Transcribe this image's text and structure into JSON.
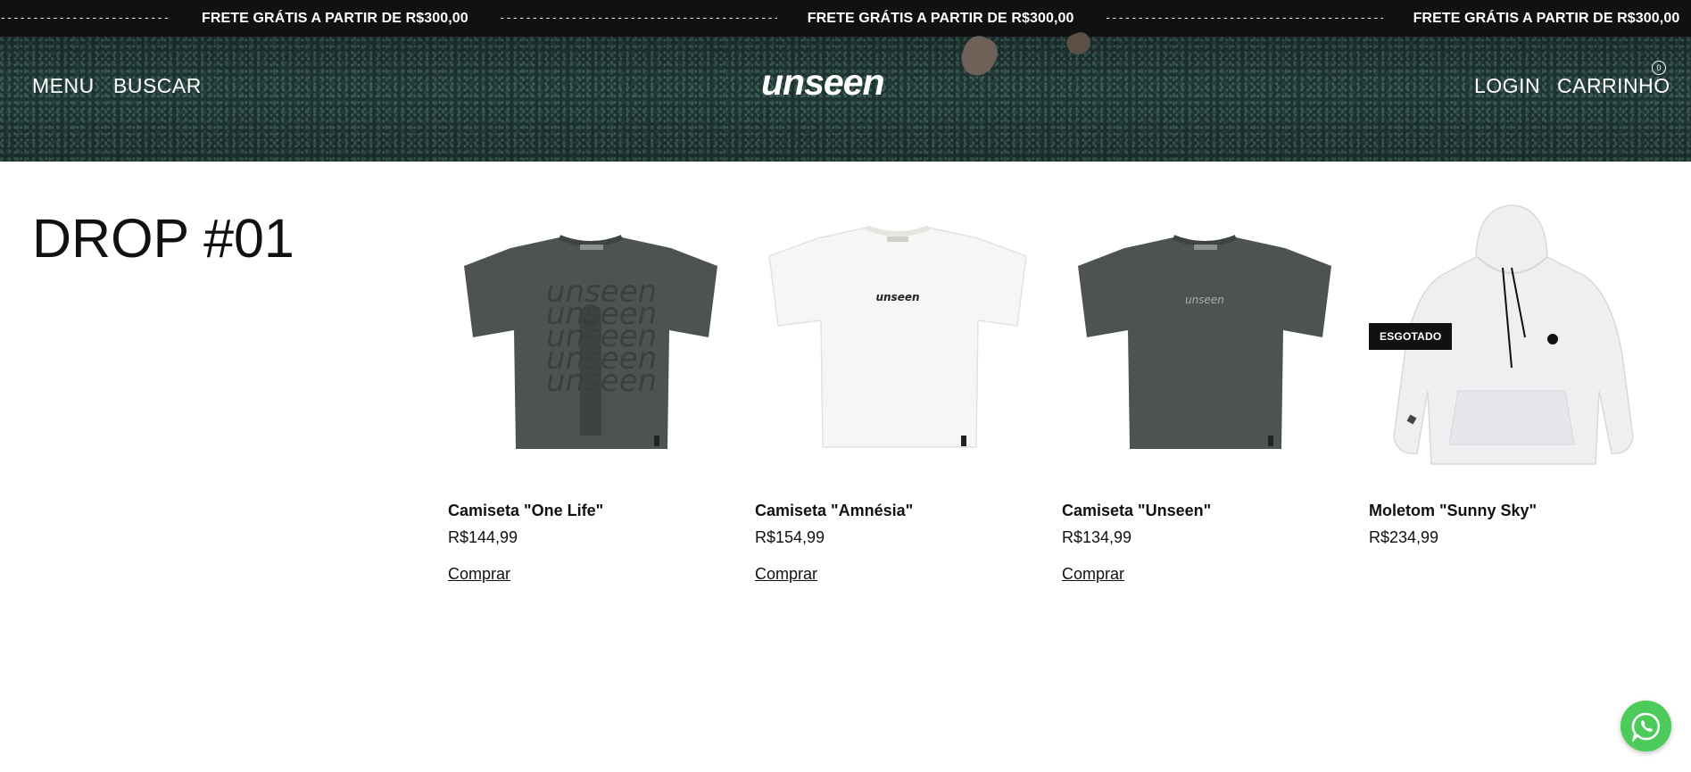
{
  "announcement": {
    "dashes": "-----------------------------------------------------",
    "message": "FRETE GRÁTIS A PARTIR DE R$300,00"
  },
  "header": {
    "menu": "MENU",
    "search": "BUSCAR",
    "logo": "unseen",
    "login": "LOGIN",
    "cart": "CARRINHO",
    "cart_count": "0"
  },
  "collection": {
    "title": "DROP #01"
  },
  "products": [
    {
      "name": "Camiseta \"One Life\"",
      "price": "R$144,99",
      "buy": "Comprar",
      "color": "#4d5450",
      "print": "",
      "sold_out": ""
    },
    {
      "name": "Camiseta \"Amnésia\"",
      "price": "R$154,99",
      "buy": "Comprar",
      "color": "#f6f6f4",
      "print": "unseen",
      "sold_out": ""
    },
    {
      "name": "Camiseta \"Unseen\"",
      "price": "R$134,99",
      "buy": "Comprar",
      "color": "#4d5450",
      "print": "unseen",
      "sold_out": ""
    },
    {
      "name": "Moletom \"Sunny Sky\"",
      "price": "R$234,99",
      "buy": "",
      "color": "#eeeff1",
      "print": "",
      "sold_out": "ESGOTADO"
    }
  ],
  "icons": {
    "whatsapp": "whatsapp-icon"
  }
}
